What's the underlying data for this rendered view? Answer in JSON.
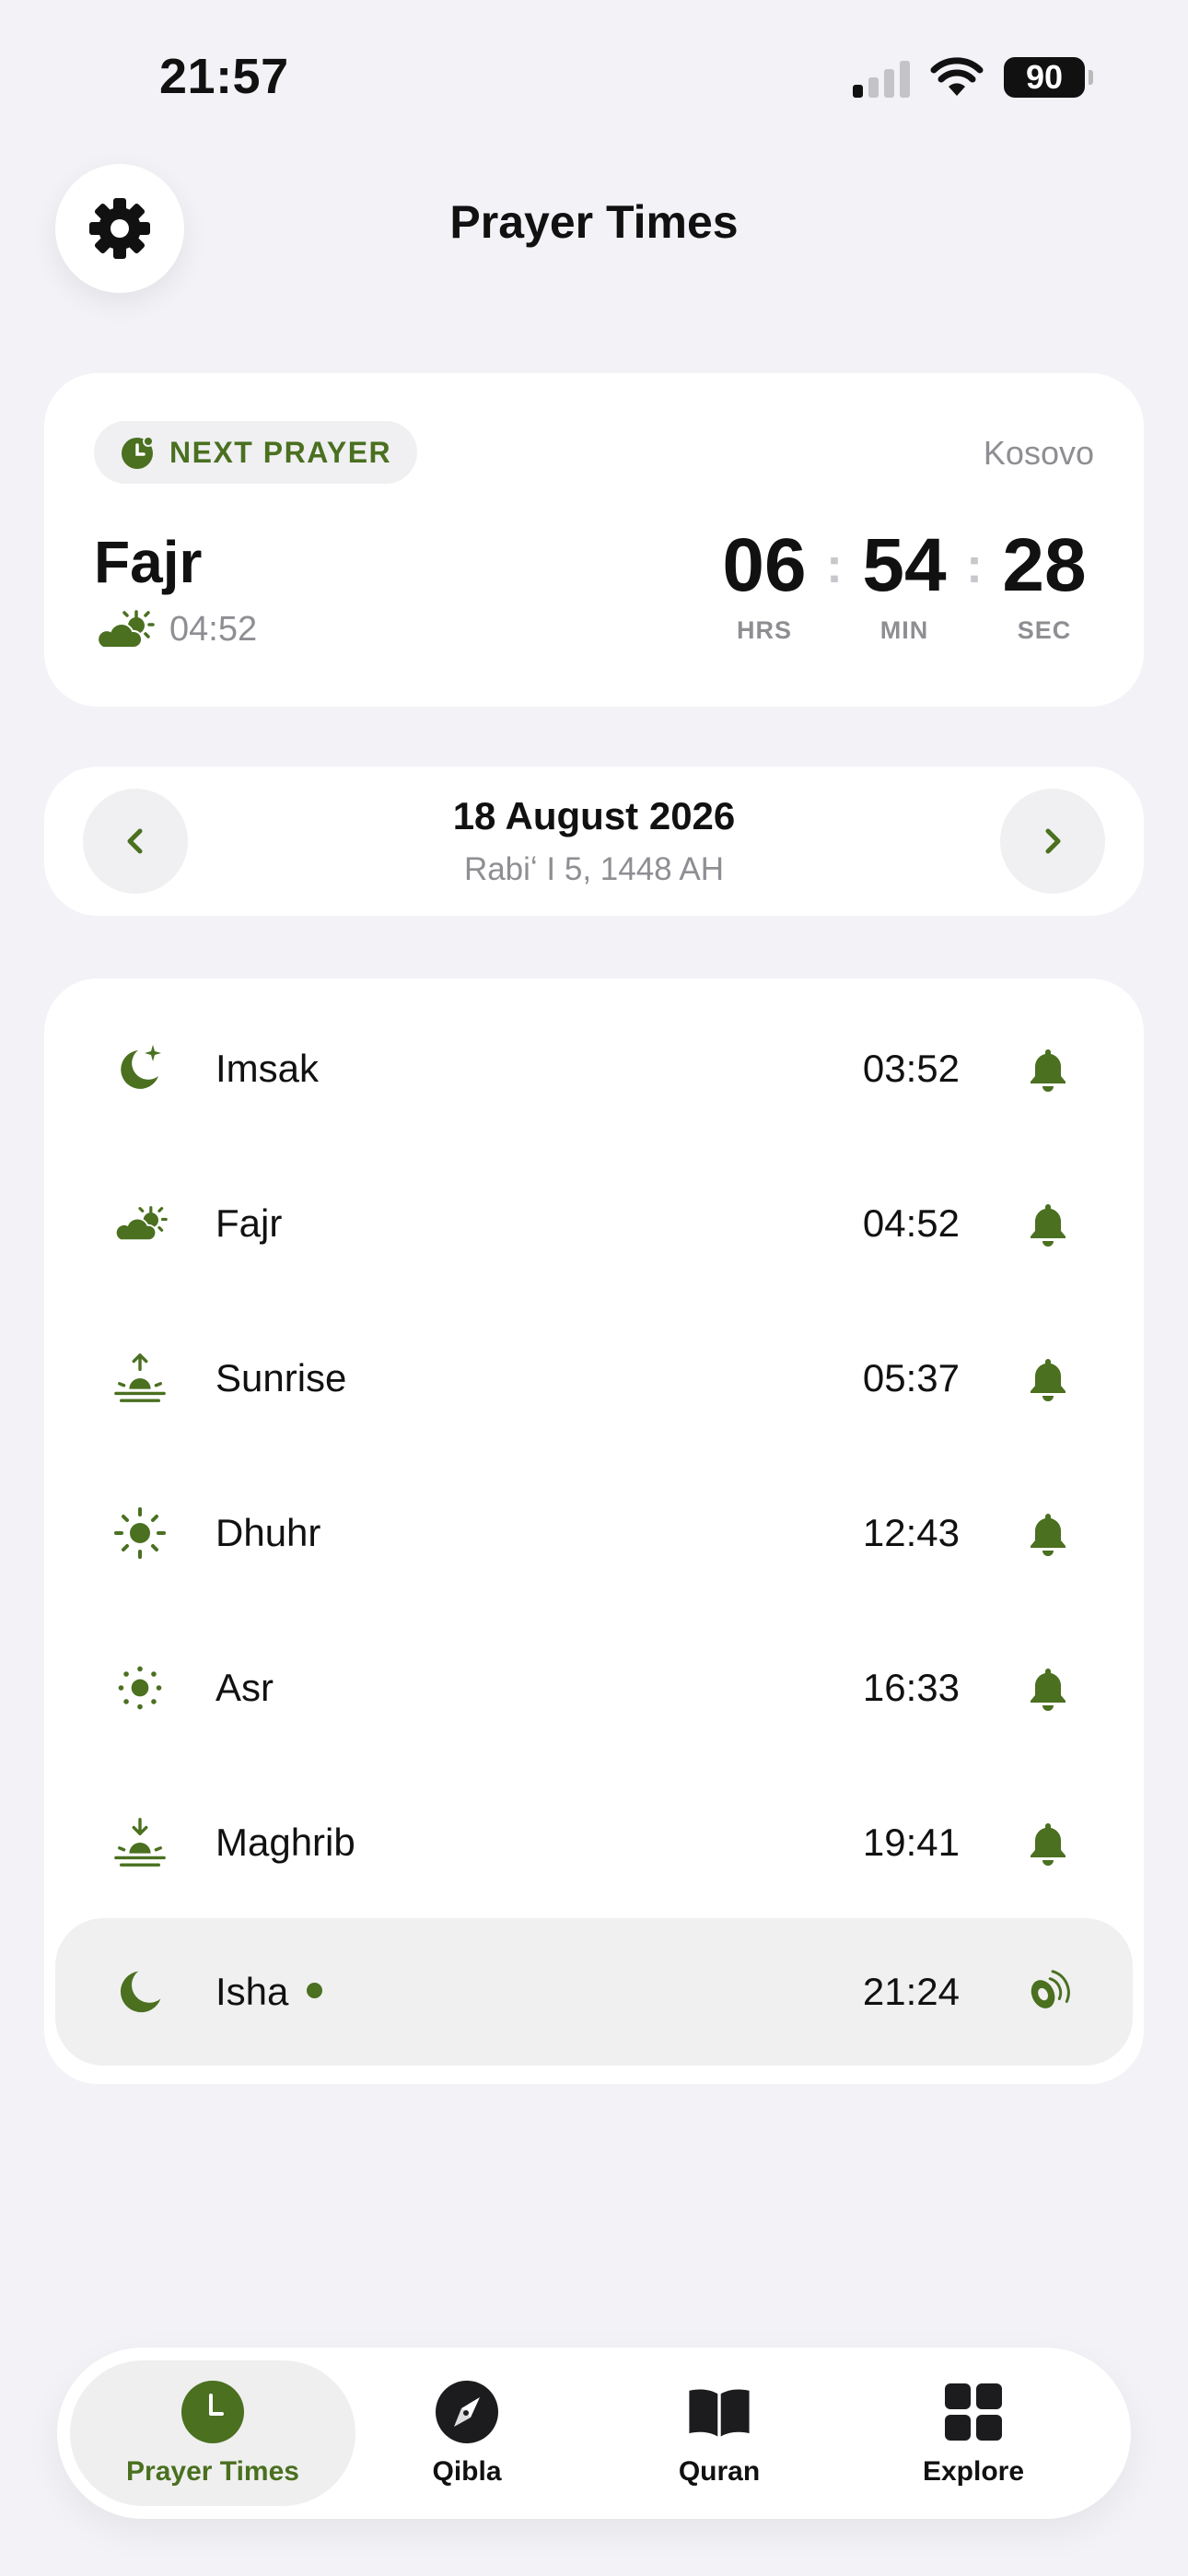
{
  "status_bar": {
    "time": "21:57",
    "battery": "90"
  },
  "header": {
    "title": "Prayer Times",
    "settings_icon": "gear-icon"
  },
  "next_prayer": {
    "chip_label": "NEXT PRAYER",
    "location": "Kosovo",
    "name": "Fajr",
    "time": "04:52",
    "countdown": {
      "hours": "06",
      "minutes": "54",
      "seconds": "28",
      "hours_label": "HRS",
      "minutes_label": "MIN",
      "seconds_label": "SEC"
    }
  },
  "date": {
    "gregorian": "18 August 2026",
    "hijri": "Rabiʻ I 5, 1448 AH"
  },
  "prayers": [
    {
      "name": "Imsak",
      "time": "03:52",
      "icon": "crescent-star-icon",
      "notification": "bell-icon"
    },
    {
      "name": "Fajr",
      "time": "04:52",
      "icon": "cloud-sun-icon",
      "notification": "bell-icon"
    },
    {
      "name": "Sunrise",
      "time": "05:37",
      "icon": "sunrise-icon",
      "notification": "bell-icon"
    },
    {
      "name": "Dhuhr",
      "time": "12:43",
      "icon": "sun-icon",
      "notification": "bell-icon"
    },
    {
      "name": "Asr",
      "time": "16:33",
      "icon": "sun-small-icon",
      "notification": "bell-icon"
    },
    {
      "name": "Maghrib",
      "time": "19:41",
      "icon": "sunset-icon",
      "notification": "bell-icon"
    },
    {
      "name": "Isha",
      "time": "21:24",
      "icon": "moon-icon",
      "notification": "speaker-icon",
      "current": true
    }
  ],
  "tabs": [
    {
      "label": "Prayer Times",
      "icon": "clock-icon",
      "active": true
    },
    {
      "label": "Qibla",
      "icon": "compass-icon"
    },
    {
      "label": "Quran",
      "icon": "book-icon"
    },
    {
      "label": "Explore",
      "icon": "grid-icon"
    }
  ],
  "colors": {
    "accent": "#4a7020",
    "background": "#f2f2f7",
    "card": "#ffffff",
    "muted": "#8e8e93"
  }
}
